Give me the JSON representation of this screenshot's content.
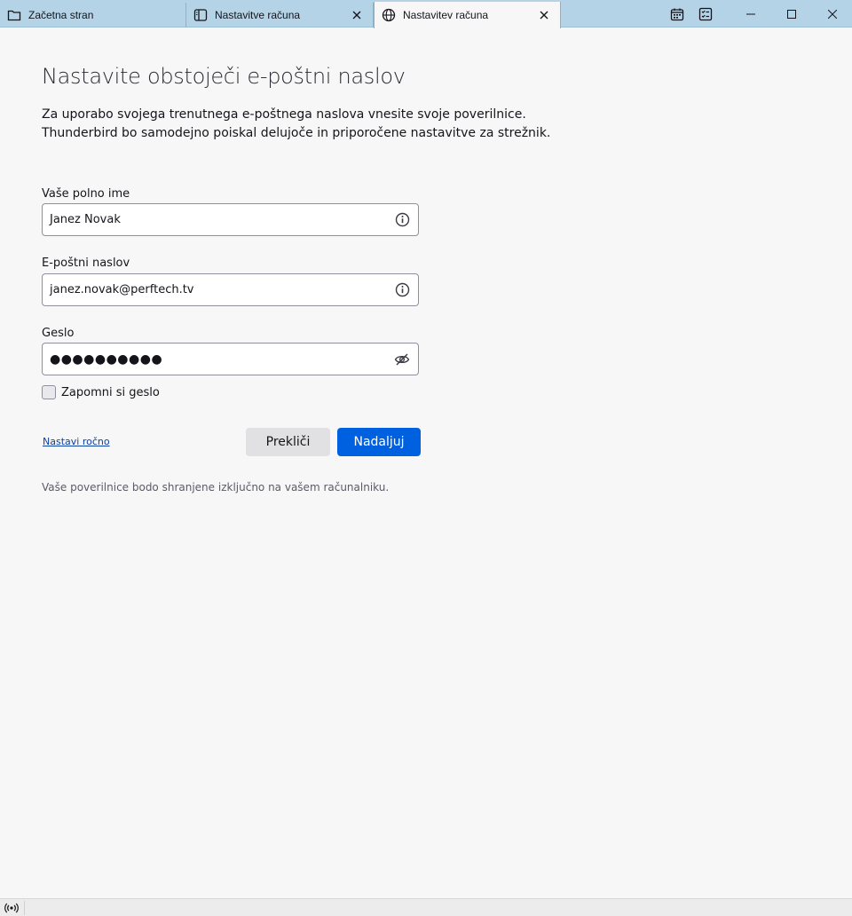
{
  "tabs": [
    {
      "label": "Začetna stran",
      "icon": "folder-icon"
    },
    {
      "label": "Nastavitve računa",
      "icon": "settings-panel-icon"
    },
    {
      "label": "Nastavitev računa",
      "icon": "globe-icon"
    }
  ],
  "window_controls": {
    "calendar": "calendar-icon",
    "tasks": "tasks-icon",
    "minimize": "minimize-icon",
    "maximize": "maximize-icon",
    "close": "close-icon"
  },
  "page": {
    "title": "Nastavite obstoječi e-poštni naslov",
    "description_line1": "Za uporabo svojega trenutnega e-poštnega naslova vnesite svoje poverilnice.",
    "description_line2": "Thunderbird bo samodejno poiskal delujoče in priporočene nastavitve za strežnik."
  },
  "form": {
    "name_label": "Vaše polno ime",
    "name_value": "Janez Novak",
    "email_label": "E-poštni naslov",
    "email_value": "janez.novak@perftech.tv",
    "password_label": "Geslo",
    "password_value": "●●●●●●●●●●",
    "remember_label": "Zapomni si geslo",
    "remember_checked": false
  },
  "actions": {
    "manual_link": "Nastavi ročno",
    "cancel": "Prekliči",
    "continue": "Nadaljuj"
  },
  "footer_note": "Vaše poverilnice bodo shranjene izključno na vašem računalniku.",
  "colors": {
    "tabbar": "#b5d3e6",
    "primary_button": "#0061e0",
    "link": "#0a3fa6"
  }
}
